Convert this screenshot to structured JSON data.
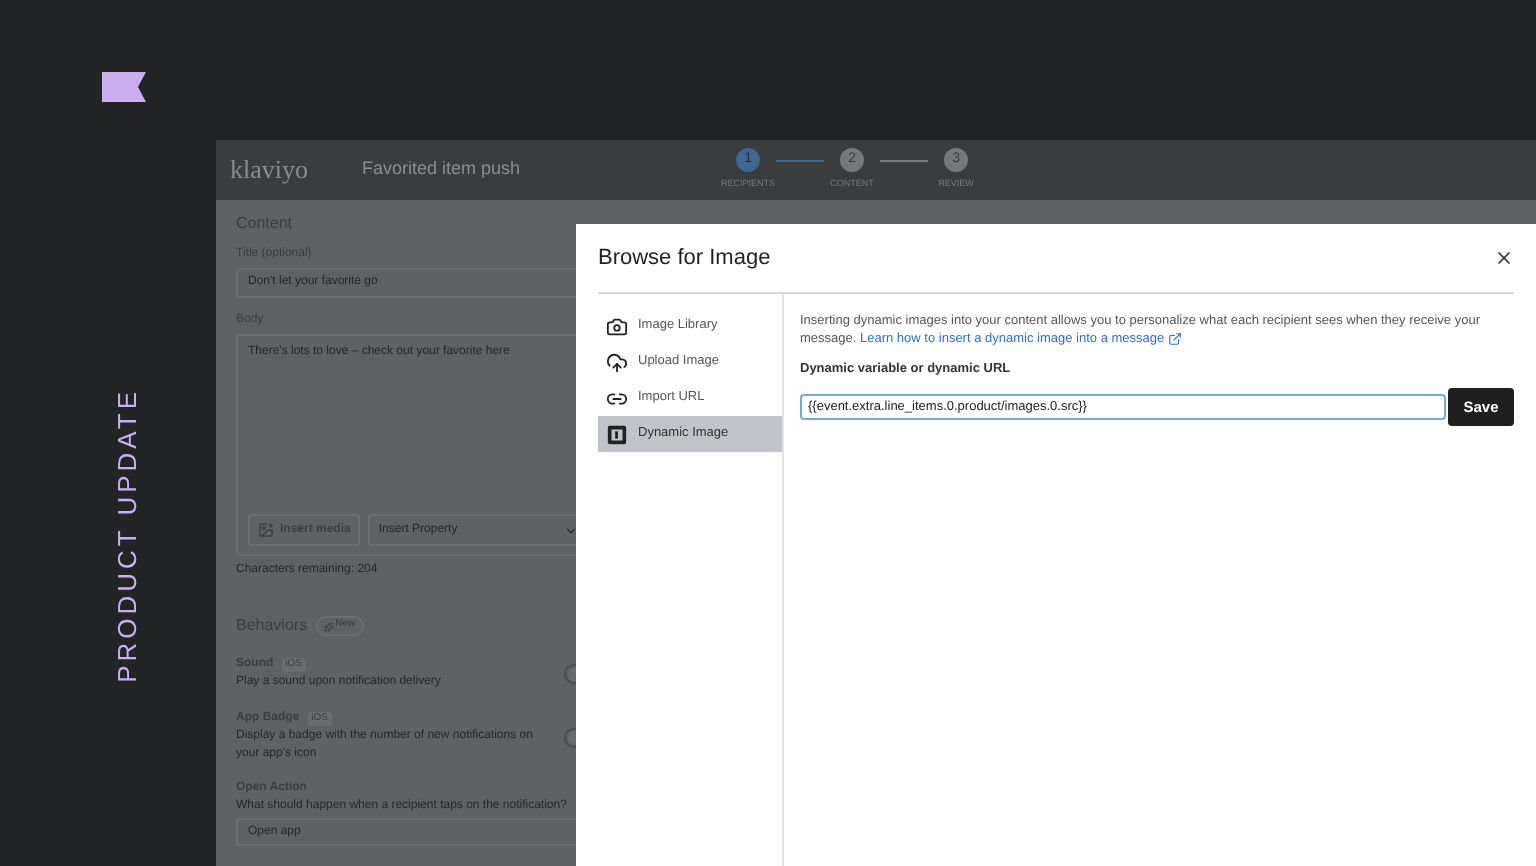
{
  "banner": {
    "label": "PRODUCT UPDATE"
  },
  "app": {
    "logo": "klaviyo",
    "title": "Favorited item push",
    "steps": [
      {
        "number": "1",
        "label": "RECIPIENTS",
        "selected": true
      },
      {
        "number": "2",
        "label": "CONTENT",
        "selected": false
      },
      {
        "number": "3",
        "label": "REVIEW",
        "selected": false
      }
    ]
  },
  "content_panel": {
    "heading": "Content",
    "title_label": "Title (optional)",
    "title_value": "Don't let your favorite go",
    "body_label": "Body",
    "body_value": "There's lots to love – check out your favorite here",
    "insert_media": "Insert media",
    "insert_property": "Insert Property",
    "characters_remaining": "Characters remaining: 204",
    "behaviors_heading": "Behaviors",
    "new_badge": "New",
    "toggles": [
      {
        "label": "Sound",
        "tag": "iOS",
        "description": "Play a sound upon notification delivery",
        "on": false
      },
      {
        "label": "App Badge",
        "tag": "iOS",
        "description": "Display a badge with the number of new notifications on your app's icon",
        "on": false
      }
    ],
    "open_action_label": "Open Action",
    "open_action_description": "What should happen when a recipient taps on the notification?",
    "open_action_value": "Open app"
  },
  "dialog": {
    "title": "Browse for Image",
    "nav": [
      {
        "kind": "camera",
        "label": "Image Library",
        "selected": false
      },
      {
        "kind": "upload",
        "label": "Upload Image",
        "selected": false
      },
      {
        "kind": "link",
        "label": "Import URL",
        "selected": false
      },
      {
        "kind": "dynamic",
        "label": "Dynamic Image",
        "selected": true
      }
    ],
    "intro": "Inserting dynamic images into your content allows you to personalize what each recipient sees when they receive your message.",
    "learn_link": "Learn how to insert a dynamic image into a message",
    "field_label": "Dynamic variable or dynamic URL",
    "field_value": "{{event.extra.line_items.0.product/images.0.src}}",
    "save": "Save"
  }
}
